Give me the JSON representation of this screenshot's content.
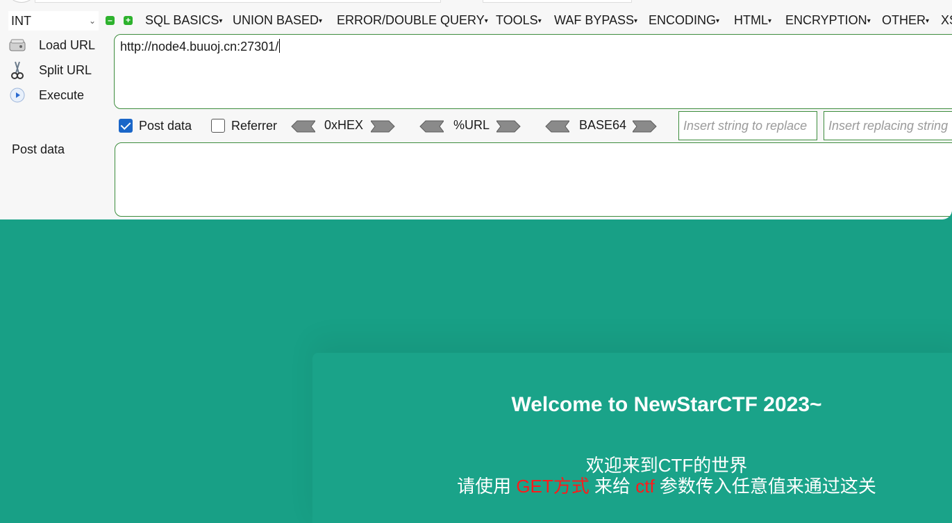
{
  "menubar": {
    "select_value": "INT",
    "items": [
      "SQL BASICS",
      "UNION BASED",
      "ERROR/DOUBLE QUERY",
      "TOOLS",
      "WAF BYPASS",
      "ENCODING",
      "HTML",
      "ENCRYPTION",
      "OTHER",
      "XS"
    ]
  },
  "side": {
    "load_url": "Load URL",
    "split_url": "Split URL",
    "execute": "Execute"
  },
  "url_value": "http://node4.buuoj.cn:27301/",
  "options": {
    "post_data_label": "Post data",
    "post_data_checked": true,
    "referrer_label": "Referrer",
    "referrer_checked": false,
    "hex_label": "0xHEX",
    "url_label": "%URL",
    "base64_label": "BASE64",
    "replace_placeholder": "Insert string to replace",
    "replacing_placeholder": "Insert replacing string"
  },
  "post_label": "Post data",
  "page": {
    "welcome": "Welcome to NewStarCTF 2023~",
    "line1": "欢迎来到CTF的世界",
    "line2_a": "请使用 ",
    "line2_method": "GET方式",
    "line2_b": " 来给 ",
    "line2_param": "ctf",
    "line2_c": " 参数传入任意值来通过这关"
  },
  "colors": {
    "page_bg": "#18a086",
    "accent_red": "#ff1a1a",
    "checkbox_blue": "#1a66c8",
    "border_green": "#3c8c3c"
  }
}
